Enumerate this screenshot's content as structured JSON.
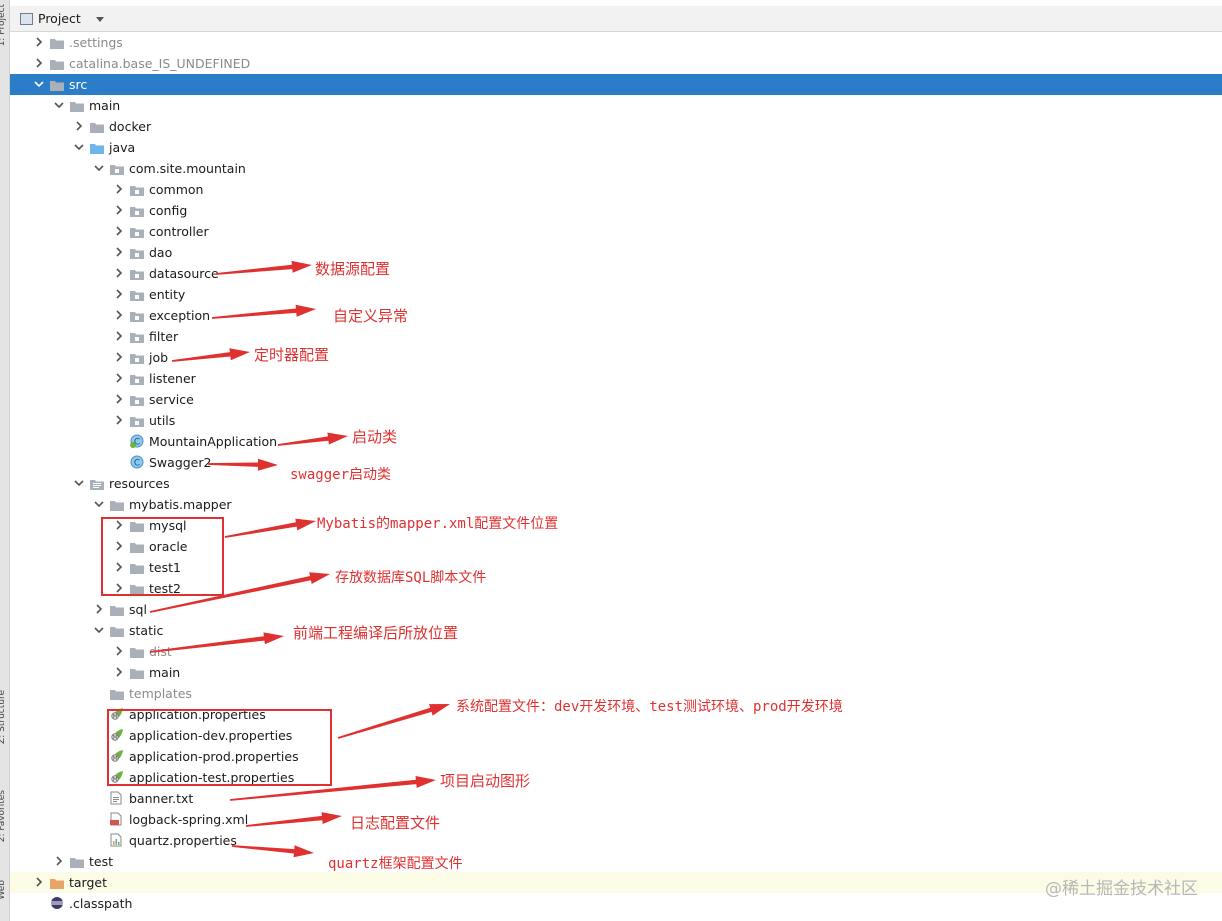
{
  "header": {
    "title": "Project"
  },
  "strip": {
    "labels": [
      "1: Project",
      "Z: Structure",
      "2: Favorites",
      "Web"
    ]
  },
  "tree": [
    {
      "label": ".settings",
      "depth": 0,
      "chevron": "right",
      "icon": "folder",
      "muted": true
    },
    {
      "label": "catalina.base_IS_UNDEFINED",
      "depth": 0,
      "chevron": "right",
      "icon": "folder",
      "muted": true
    },
    {
      "label": "src",
      "depth": 0,
      "chevron": "down",
      "icon": "folder",
      "selected": true
    },
    {
      "label": "main",
      "depth": 1,
      "chevron": "down",
      "icon": "folder"
    },
    {
      "label": "docker",
      "depth": 2,
      "chevron": "right",
      "icon": "folder"
    },
    {
      "label": "java",
      "depth": 2,
      "chevron": "down",
      "icon": "folder-source"
    },
    {
      "label": "com.site.mountain",
      "depth": 3,
      "chevron": "down",
      "icon": "package"
    },
    {
      "label": "common",
      "depth": 4,
      "chevron": "right",
      "icon": "package"
    },
    {
      "label": "config",
      "depth": 4,
      "chevron": "right",
      "icon": "package"
    },
    {
      "label": "controller",
      "depth": 4,
      "chevron": "right",
      "icon": "package"
    },
    {
      "label": "dao",
      "depth": 4,
      "chevron": "right",
      "icon": "package"
    },
    {
      "label": "datasource",
      "depth": 4,
      "chevron": "right",
      "icon": "package"
    },
    {
      "label": "entity",
      "depth": 4,
      "chevron": "right",
      "icon": "package"
    },
    {
      "label": "exception",
      "depth": 4,
      "chevron": "right",
      "icon": "package"
    },
    {
      "label": "filter",
      "depth": 4,
      "chevron": "right",
      "icon": "package"
    },
    {
      "label": "job",
      "depth": 4,
      "chevron": "right",
      "icon": "package"
    },
    {
      "label": "listener",
      "depth": 4,
      "chevron": "right",
      "icon": "package"
    },
    {
      "label": "service",
      "depth": 4,
      "chevron": "right",
      "icon": "package"
    },
    {
      "label": "utils",
      "depth": 4,
      "chevron": "right",
      "icon": "package"
    },
    {
      "label": "MountainApplication",
      "depth": 4,
      "chevron": "none",
      "icon": "spring-class"
    },
    {
      "label": "Swagger2",
      "depth": 4,
      "chevron": "none",
      "icon": "class"
    },
    {
      "label": "resources",
      "depth": 2,
      "chevron": "down",
      "icon": "folder-resources"
    },
    {
      "label": "mybatis.mapper",
      "depth": 3,
      "chevron": "down",
      "icon": "folder"
    },
    {
      "label": "mysql",
      "depth": 4,
      "chevron": "right",
      "icon": "folder"
    },
    {
      "label": "oracle",
      "depth": 4,
      "chevron": "right",
      "icon": "folder"
    },
    {
      "label": "test1",
      "depth": 4,
      "chevron": "right",
      "icon": "folder"
    },
    {
      "label": "test2",
      "depth": 4,
      "chevron": "right",
      "icon": "folder"
    },
    {
      "label": "sql",
      "depth": 3,
      "chevron": "right",
      "icon": "folder"
    },
    {
      "label": "static",
      "depth": 3,
      "chevron": "down",
      "icon": "folder"
    },
    {
      "label": "dist",
      "depth": 4,
      "chevron": "right",
      "icon": "folder",
      "muted": true
    },
    {
      "label": "main",
      "depth": 4,
      "chevron": "right",
      "icon": "folder"
    },
    {
      "label": "templates",
      "depth": 3,
      "chevron": "none",
      "icon": "folder",
      "muted": true
    },
    {
      "label": "application.properties",
      "depth": 3,
      "chevron": "none",
      "icon": "spring-properties"
    },
    {
      "label": "application-dev.properties",
      "depth": 3,
      "chevron": "none",
      "icon": "spring-properties"
    },
    {
      "label": "application-prod.properties",
      "depth": 3,
      "chevron": "none",
      "icon": "spring-properties"
    },
    {
      "label": "application-test.properties",
      "depth": 3,
      "chevron": "none",
      "icon": "spring-properties"
    },
    {
      "label": "banner.txt",
      "depth": 3,
      "chevron": "none",
      "icon": "text-file"
    },
    {
      "label": "logback-spring.xml",
      "depth": 3,
      "chevron": "none",
      "icon": "xml-file"
    },
    {
      "label": "quartz.properties",
      "depth": 3,
      "chevron": "none",
      "icon": "properties-file"
    },
    {
      "label": "test",
      "depth": 1,
      "chevron": "right",
      "icon": "folder"
    },
    {
      "label": "target",
      "depth": 0,
      "chevron": "right",
      "icon": "folder-excluded",
      "highlight": true
    },
    {
      "label": ".classpath",
      "depth": 0,
      "chevron": "none",
      "icon": "eclipse-file"
    }
  ],
  "annotations": [
    {
      "text": "数据源配置"
    },
    {
      "text": "自定义异常"
    },
    {
      "text": "定时器配置"
    },
    {
      "text": "启动类"
    },
    {
      "text": "swagger启动类"
    },
    {
      "text": "Mybatis的mapper.xml配置文件位置"
    },
    {
      "text": "存放数据库SQL脚本文件"
    },
    {
      "text": "前端工程编译后所放位置"
    },
    {
      "text": "系统配置文件：dev开发环境、test测试环境、prod开发环境"
    },
    {
      "text": "项目启动图形"
    },
    {
      "text": "日志配置文件"
    },
    {
      "text": "quartz框架配置文件"
    }
  ],
  "watermark": "@稀土掘金技术社区",
  "colors": {
    "selection": "#2c7dc7",
    "annotation": "#e03131",
    "folder": "#a9b0b8",
    "source_folder": "#6fb6e8"
  }
}
